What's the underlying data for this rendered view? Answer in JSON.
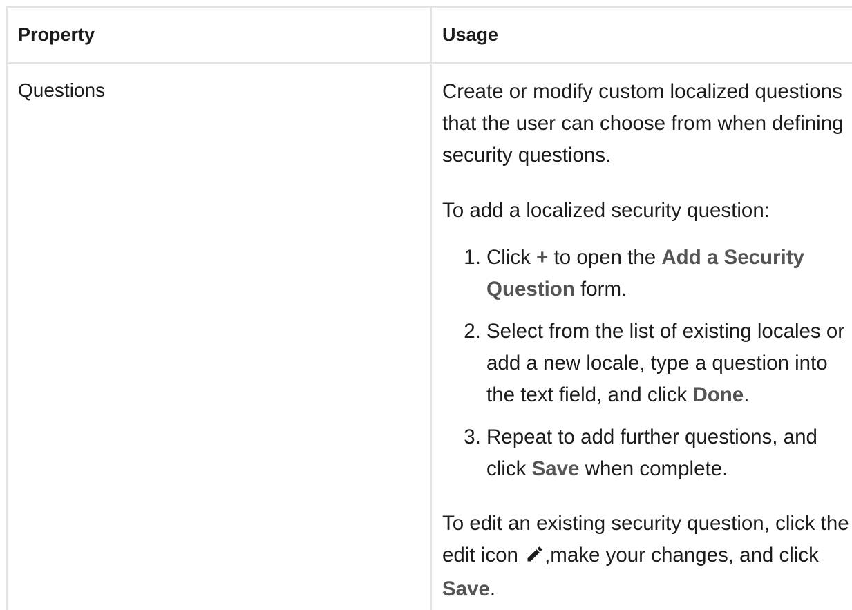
{
  "table": {
    "headers": {
      "property": "Property",
      "usage": "Usage"
    },
    "rows": [
      {
        "property": "Questions",
        "usage": {
          "intro": "Create or modify custom localized questions that the user can choose from when defining security questions.",
          "add_heading": "To add a localized security question:",
          "steps": [
            {
              "t1": "Click ",
              "b1": "+",
              "t2": " to open the ",
              "b2": "Add a Security Question",
              "t3": " form."
            },
            {
              "t1": "Select from the list of existing locales or add a new locale, type a question into the text field, and click ",
              "b1": "Done",
              "t2": "."
            },
            {
              "t1": "Repeat to add further questions, and click ",
              "b1": "Save",
              "t2": " when complete."
            }
          ],
          "edit": {
            "t1": "To edit an existing security question, click the edit icon ",
            "icon": "pencil-icon",
            "t2": ",make your changes, and click ",
            "b1": "Save",
            "t3": "."
          }
        }
      }
    ]
  }
}
